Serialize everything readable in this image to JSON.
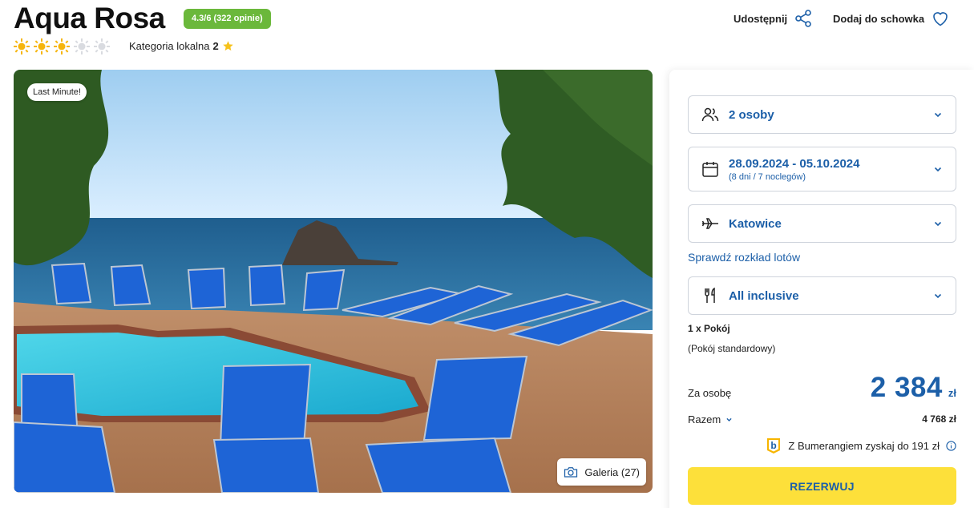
{
  "header": {
    "hotel_name": "Aqua Rosa",
    "rating_badge": "4.3/6 (322 opinie)",
    "sun_rating": {
      "filled": 3,
      "total": 5
    },
    "category_label": "Kategoria lokalna",
    "category_value": "2",
    "share_label": "Udostępnij",
    "favorite_label": "Dodaj do schowka"
  },
  "gallery": {
    "badge": "Last Minute!",
    "button_label": "Galeria (27)"
  },
  "booking": {
    "persons": "2 osoby",
    "dates": "28.09.2024 - 05.10.2024",
    "dates_sub": "(8 dni / 7 noclegów)",
    "departure": "Katowice",
    "flights_link": "Sprawdź rozkład lotów",
    "board": "All inclusive",
    "room_qty": "1 x Pokój",
    "room_type": "(Pokój standardowy)",
    "per_person_label": "Za osobę",
    "price": "2 384",
    "currency": "zł",
    "total_label": "Razem",
    "total_value": "4 768 zł",
    "bumerang_text": "Z Bumerangiem zyskaj do 191 zł",
    "reserve_label": "REZERWUJ"
  },
  "colors": {
    "accent_blue": "#1c5fa8",
    "rating_green": "#6bb83b",
    "reserve_yellow": "#fde03a",
    "sun_yellow": "#f6b50d"
  }
}
